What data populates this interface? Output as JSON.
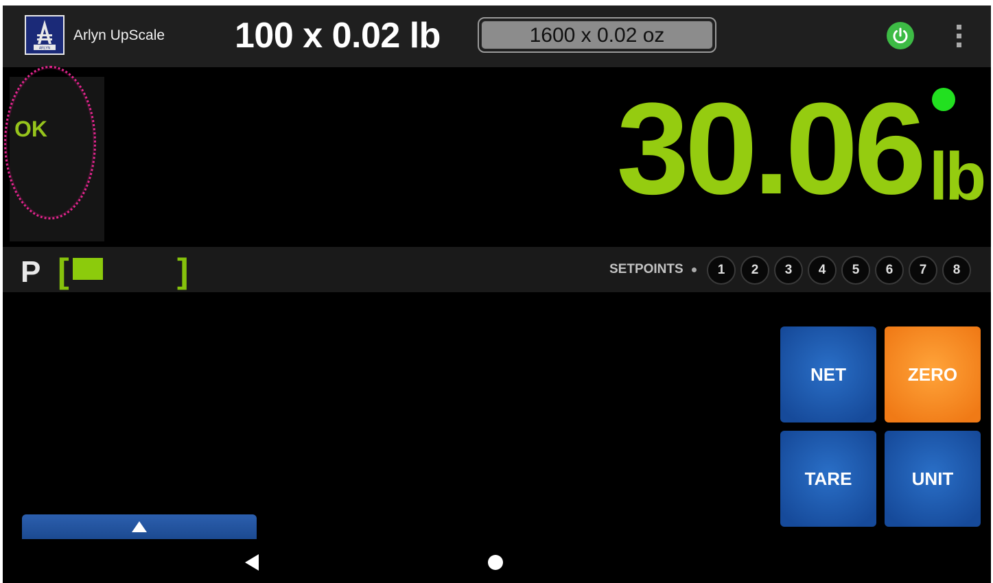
{
  "app": {
    "title": "Arlyn UpScale"
  },
  "header": {
    "capacity_primary": "100 x 0.02 lb",
    "capacity_secondary": "1600 x 0.02 oz",
    "logo_text": "ARLYN"
  },
  "status": {
    "ok_label": "OK"
  },
  "display": {
    "weight": "30.06",
    "unit": "lb",
    "stable_color": "#22e020",
    "accent_color": "#95cc10"
  },
  "progress_bar": {
    "label": "P",
    "open_bracket": "[",
    "close_bracket": "]",
    "fill_fraction": 0.25
  },
  "setpoints": {
    "label": "SETPOINTS",
    "items": [
      "1",
      "2",
      "3",
      "4",
      "5",
      "6",
      "7",
      "8"
    ]
  },
  "buttons": {
    "net": "NET",
    "zero": "ZERO",
    "tare": "TARE",
    "unit": "UNIT"
  },
  "colors": {
    "button_blue": "#1e5bb0",
    "button_orange": "#f28a22"
  },
  "icons": {
    "power": "power-icon",
    "menu": "more-vert-icon",
    "drawer": "triangle-up-icon",
    "nav_back": "back-triangle-icon",
    "nav_home": "home-circle-icon"
  }
}
